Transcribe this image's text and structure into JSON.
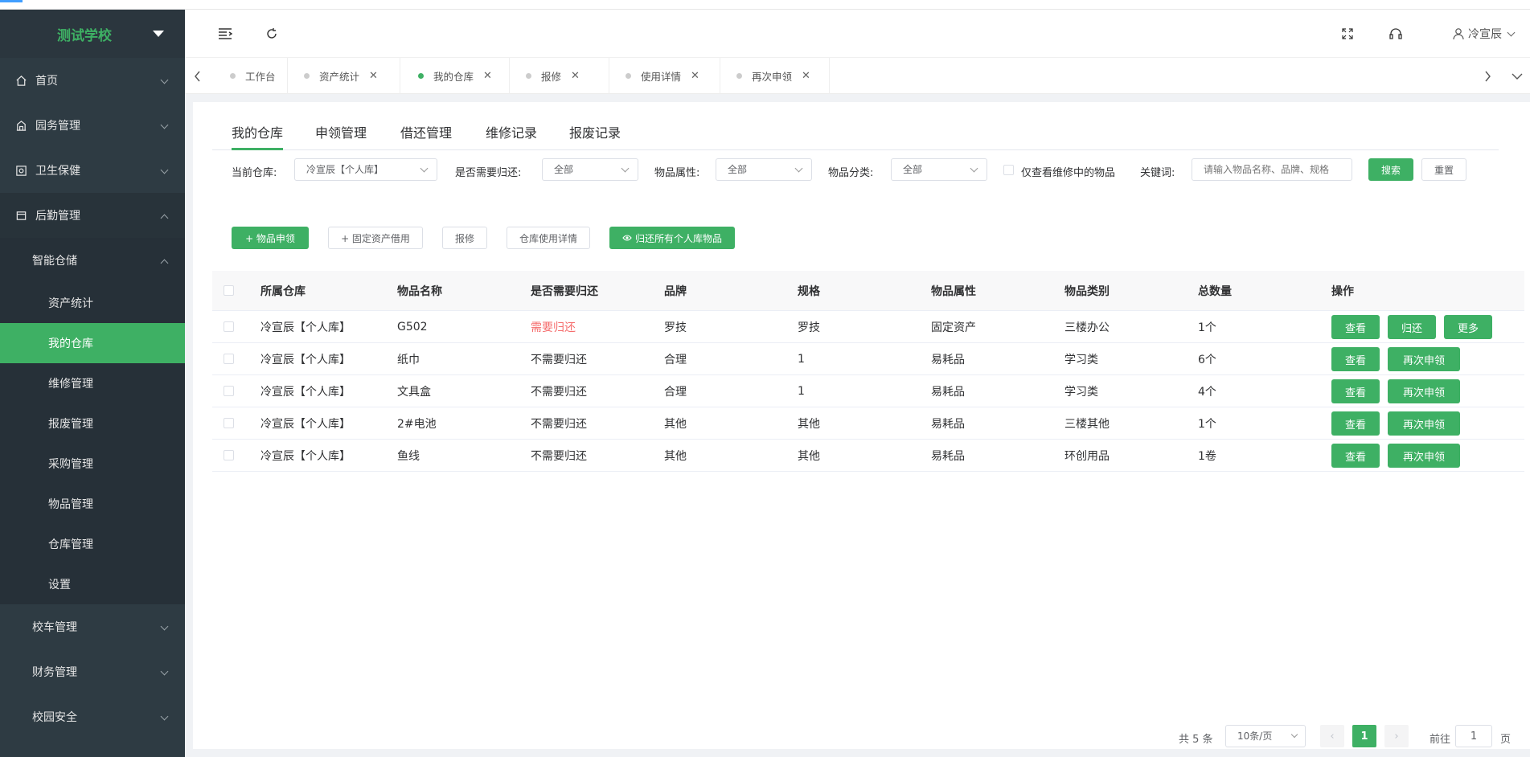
{
  "sidebar": {
    "school": "测试学校",
    "menu": [
      {
        "label": "首页",
        "icon": "home-icon"
      },
      {
        "label": "园务管理",
        "icon": "building-icon"
      },
      {
        "label": "卫生保健",
        "icon": "health-icon"
      },
      {
        "label": "后勤管理",
        "icon": "logistics-icon"
      }
    ],
    "submenu_parent": "智能仓储",
    "subitems": [
      "资产统计",
      "我的仓库",
      "维修管理",
      "报废管理",
      "采购管理",
      "物品管理",
      "仓库管理",
      "设置"
    ],
    "bottom_menu": [
      "校车管理",
      "财务管理",
      "校园安全"
    ]
  },
  "header": {
    "user": "冷宣辰"
  },
  "tabs": [
    "工作台",
    "资产统计",
    "我的仓库",
    "报修",
    "使用详情",
    "再次申领"
  ],
  "subtabs": [
    "我的仓库",
    "申领管理",
    "借还管理",
    "维修记录",
    "报废记录"
  ],
  "filters": {
    "warehouse_label": "当前仓库:",
    "warehouse_value": "冷宣辰【个人库】",
    "return_label": "是否需要归还:",
    "return_value": "全部",
    "attr_label": "物品属性:",
    "attr_value": "全部",
    "category_label": "物品分类:",
    "category_value": "全部",
    "repair_only_label": "仅查看维修中的物品",
    "keyword_label": "关键词:",
    "keyword_placeholder": "请输入物品名称、品牌、规格",
    "search_label": "搜索",
    "reset_label": "重置"
  },
  "actions": {
    "apply": "+ 物品申领",
    "fixed_borrow": "+ 固定资产借用",
    "repair": "报修",
    "usage": "仓库使用详情",
    "return_all": "归还所有个人库物品"
  },
  "table": {
    "headers": [
      "所属仓库",
      "物品名称",
      "是否需要归还",
      "品牌",
      "规格",
      "物品属性",
      "物品类别",
      "总数量",
      "操作"
    ],
    "rows": [
      {
        "warehouse": "冷宣辰【个人库】",
        "name": "G502",
        "need_return": "需要归还",
        "brand": "罗技",
        "spec": "罗技",
        "attr": "固定资产",
        "category": "三楼办公",
        "qty": "1个",
        "ops": [
          "查看",
          "归还",
          "更多"
        ]
      },
      {
        "warehouse": "冷宣辰【个人库】",
        "name": "纸巾",
        "need_return": "不需要归还",
        "brand": "合理",
        "spec": "1",
        "attr": "易耗品",
        "category": "学习类",
        "qty": "6个",
        "ops": [
          "查看",
          "再次申领"
        ]
      },
      {
        "warehouse": "冷宣辰【个人库】",
        "name": "文具盒",
        "need_return": "不需要归还",
        "brand": "合理",
        "spec": "1",
        "attr": "易耗品",
        "category": "学习类",
        "qty": "4个",
        "ops": [
          "查看",
          "再次申领"
        ]
      },
      {
        "warehouse": "冷宣辰【个人库】",
        "name": "2#电池",
        "need_return": "不需要归还",
        "brand": "其他",
        "spec": "其他",
        "attr": "易耗品",
        "category": "三楼其他",
        "qty": "1个",
        "ops": [
          "查看",
          "再次申领"
        ]
      },
      {
        "warehouse": "冷宣辰【个人库】",
        "name": "鱼线",
        "need_return": "不需要归还",
        "brand": "其他",
        "spec": "其他",
        "attr": "易耗品",
        "category": "环创用品",
        "qty": "1卷",
        "ops": [
          "查看",
          "再次申领"
        ]
      }
    ]
  },
  "pagination": {
    "total": "共 5 条",
    "page_size": "10条/页",
    "current": "1",
    "goto_label": "前往",
    "goto_value": "1",
    "page_suffix": "页"
  },
  "colors": {
    "accent": "#3eb064",
    "sidebar": "#2e3b43",
    "danger": "#f56c6c"
  }
}
